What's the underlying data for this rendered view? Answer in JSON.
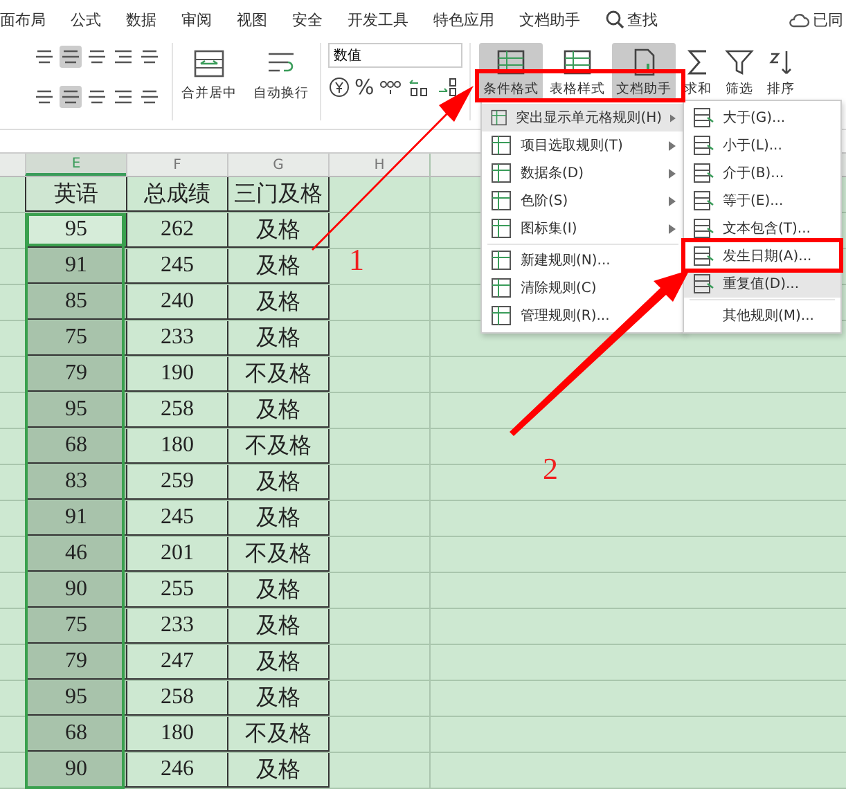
{
  "ribbon": {
    "tabs": [
      {
        "label": "面布局"
      },
      {
        "label": "公式"
      },
      {
        "label": "数据"
      },
      {
        "label": "审阅"
      },
      {
        "label": "视图"
      },
      {
        "label": "安全"
      },
      {
        "label": "开发工具"
      },
      {
        "label": "特色应用"
      },
      {
        "label": "文档助手"
      }
    ],
    "search": "查找",
    "cloud_status": "已同"
  },
  "toolbar": {
    "align_buttons": [
      {
        "selected": false
      },
      {
        "selected": true
      },
      {
        "selected": false
      },
      {
        "selected": false
      },
      {
        "selected": false
      },
      {
        "selected": false
      },
      {
        "selected": true
      },
      {
        "selected": false
      },
      {
        "selected": false
      },
      {
        "selected": false
      }
    ],
    "merge": "合并居中",
    "wrap": "自动换行",
    "number_format": "数值",
    "percent": "%",
    "big_buttons": [
      {
        "label": "条件格式",
        "selected": true
      },
      {
        "label": "表格样式",
        "selected": false
      },
      {
        "label": "文档助手",
        "selected": true
      },
      {
        "label": "求和",
        "selected": false
      },
      {
        "label": "筛选",
        "selected": false
      },
      {
        "label": "排序",
        "selected": false
      }
    ]
  },
  "columns": [
    {
      "label": "E",
      "selected": true
    },
    {
      "label": "F",
      "selected": false
    },
    {
      "label": "G",
      "selected": false
    },
    {
      "label": "H",
      "selected": false
    }
  ],
  "header": [
    "英语",
    "总成绩",
    "三门及格"
  ],
  "rows": [
    {
      "english": "95",
      "total": "262",
      "pass": "及格",
      "active": true
    },
    {
      "english": "91",
      "total": "245",
      "pass": "及格",
      "active": false
    },
    {
      "english": "85",
      "total": "240",
      "pass": "及格",
      "active": false
    },
    {
      "english": "75",
      "total": "233",
      "pass": "及格",
      "active": false
    },
    {
      "english": "79",
      "total": "190",
      "pass": "不及格",
      "active": false
    },
    {
      "english": "95",
      "total": "258",
      "pass": "及格",
      "active": false
    },
    {
      "english": "68",
      "total": "180",
      "pass": "不及格",
      "active": false
    },
    {
      "english": "83",
      "total": "259",
      "pass": "及格",
      "active": false
    },
    {
      "english": "91",
      "total": "245",
      "pass": "及格",
      "active": false
    },
    {
      "english": "46",
      "total": "201",
      "pass": "不及格",
      "active": false
    },
    {
      "english": "90",
      "total": "255",
      "pass": "及格",
      "active": false
    },
    {
      "english": "75",
      "total": "233",
      "pass": "及格",
      "active": false
    },
    {
      "english": "79",
      "total": "247",
      "pass": "及格",
      "active": false
    },
    {
      "english": "95",
      "total": "258",
      "pass": "及格",
      "active": false
    },
    {
      "english": "68",
      "total": "180",
      "pass": "不及格",
      "active": false
    },
    {
      "english": "90",
      "total": "246",
      "pass": "及格",
      "active": false
    }
  ],
  "menu": [
    {
      "label": "突出显示单元格规则(H)",
      "kind": "submenu",
      "highlighted": true
    },
    {
      "label": "项目选取规则(T)",
      "kind": "submenu",
      "highlighted": false
    },
    {
      "label": "数据条(D)",
      "kind": "submenu",
      "highlighted": false
    },
    {
      "label": "色阶(S)",
      "kind": "submenu",
      "highlighted": false
    },
    {
      "label": "图标集(I)",
      "kind": "submenu",
      "highlighted": false
    },
    {
      "label": "新建规则(N)...",
      "kind": "action",
      "highlighted": false
    },
    {
      "label": "清除规则(C)",
      "kind": "action",
      "highlighted": false
    },
    {
      "label": "管理规则(R)...",
      "kind": "action",
      "highlighted": false
    }
  ],
  "submenu": [
    {
      "label": "大于(G)...",
      "kind": "rule",
      "highlighted": false
    },
    {
      "label": "小于(L)...",
      "kind": "rule",
      "highlighted": false
    },
    {
      "label": "介于(B)...",
      "kind": "rule",
      "highlighted": false
    },
    {
      "label": "等于(E)...",
      "kind": "rule",
      "highlighted": false
    },
    {
      "label": "文本包含(T)...",
      "kind": "rule",
      "highlighted": false
    },
    {
      "label": "发生日期(A)...",
      "kind": "rule",
      "highlighted": false
    },
    {
      "label": "重复值(D)...",
      "kind": "rule",
      "highlighted": true
    },
    {
      "label": "其他规则(M)...",
      "kind": "plain",
      "highlighted": false
    }
  ],
  "annotations": [
    {
      "label": "1"
    },
    {
      "label": "2"
    }
  ]
}
